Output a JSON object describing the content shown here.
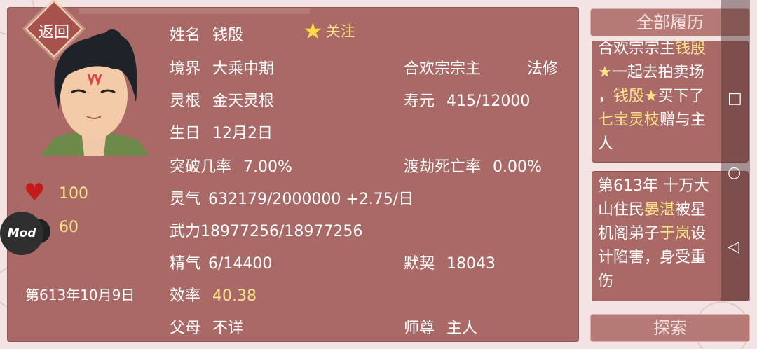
{
  "back_label": "返回",
  "character": {
    "name_label": "姓名",
    "name": "钱殷",
    "follow_label": "关注",
    "realm_label": "境界",
    "realm": "大乘中期",
    "sect_title": "合欢宗宗主",
    "class": "法修",
    "root_label": "灵根",
    "root": "金天灵根",
    "lifespan_label": "寿元",
    "lifespan": "415/12000",
    "birthday_label": "生日",
    "birthday": "12月2日",
    "breakthrough_label": "突破几率",
    "breakthrough": "7.00%",
    "tribulation_label": "渡劫死亡率",
    "tribulation": "0.00%",
    "qi_label": "灵气",
    "qi": "632179/2000000 +2.75/日",
    "force_label": "武力",
    "force": "18977256/18977256",
    "essence_label": "精气",
    "essence": "6/14400",
    "rapport_label": "默契",
    "rapport": "18043",
    "efficiency_label": "效率",
    "efficiency": "40.38",
    "parents_label": "父母",
    "parents": "不详",
    "master_label": "师尊",
    "master": "主人",
    "hp": "100",
    "mp": "60"
  },
  "mod_label": "Mod",
  "game_date": "第613年10月9日",
  "history_button": "全部履历",
  "explore_button": "探索",
  "log1": {
    "l1": "合欢宗宗主",
    "l1_name": "钱殷",
    "l2_star": "★",
    "l2": "一起去拍卖场",
    "l3a": "，",
    "l3_name": "钱殷",
    "l3_star": "★",
    "l3b": "买下了",
    "l4_item": "七宝灵枝",
    "l4b": "赠与主",
    "l5": "人"
  },
  "log2": {
    "l1": "第613年 十万大",
    "l2a": "山住民",
    "l2_name": "晏湛",
    "l2b": "被星",
    "l3a": "机阁弟子",
    "l3_name": "于岚",
    "l3b": "设",
    "l4": "计陷害，身受重",
    "l5": "伤"
  },
  "nav": {
    "square": "□",
    "circle": "○",
    "back": "◁"
  },
  "colors": {
    "panel": "#a96a67",
    "highlight": "#ffe38a",
    "heart": "#c41a1a"
  }
}
